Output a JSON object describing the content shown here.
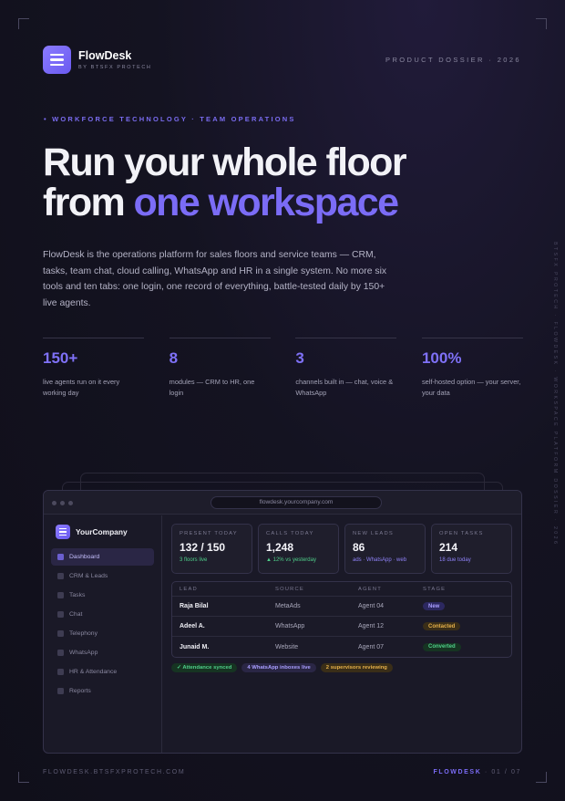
{
  "brand": {
    "name": "FlowDesk",
    "sub": "BY BTSFX PROTECH",
    "logo_icon": "stack-lines-icon"
  },
  "dossier": "PRODUCT DOSSIER · 2026",
  "eyebrow": "• WORKFORCE TECHNOLOGY · TEAM OPERATIONS",
  "headline": {
    "line1": "Run your whole floor",
    "line2_plain": "from ",
    "line2_accent": "one workspace"
  },
  "lede": "FlowDesk is the operations platform for sales floors and service teams — CRM, tasks, team chat, cloud calling, WhatsApp and HR in a single system. No more six tools and ten tabs: one login, one record of everything, battle-tested daily by 150+ live agents.",
  "stats": [
    {
      "num": "150+",
      "label": "live agents run on it every working day"
    },
    {
      "num": "8",
      "label": "modules — CRM to HR, one login"
    },
    {
      "num": "3",
      "label": "channels built in — chat, voice & WhatsApp"
    },
    {
      "num": "100%",
      "label": "self-hosted option — your server, your data"
    }
  ],
  "side_text": "BTSFX PROTECH · FLOWDESK · WORKSPACE PLATFORM DOSSIER · 2026",
  "app": {
    "url": "flowdesk.yourcompany.com",
    "company": "YourCompany",
    "nav": [
      "Dashboard",
      "CRM & Leads",
      "Tasks",
      "Chat",
      "Telephony",
      "WhatsApp",
      "HR & Attendance",
      "Reports"
    ],
    "cards": [
      {
        "label": "PRESENT TODAY",
        "value": "132 / 150",
        "sub": "3 floors live"
      },
      {
        "label": "CALLS TODAY",
        "value": "1,248",
        "sub": "▲ 12% vs yesterday"
      },
      {
        "label": "NEW LEADS",
        "value": "86",
        "sub": "ads · WhatsApp · web"
      },
      {
        "label": "OPEN TASKS",
        "value": "214",
        "sub": "18 due today"
      }
    ],
    "table": {
      "headers": [
        "LEAD",
        "SOURCE",
        "AGENT",
        "STAGE"
      ],
      "rows": [
        [
          "Raja Bilal",
          "MetaAds",
          "Agent 04",
          "New"
        ],
        [
          "Adeel A.",
          "WhatsApp",
          "Agent 12",
          "Contacted"
        ],
        [
          "Junaid M.",
          "Website",
          "Agent 07",
          "Converted"
        ]
      ]
    },
    "tags": [
      "✓ Attendance synced",
      "4 WhatsApp inboxes live",
      "2 supervisors reviewing"
    ]
  },
  "footer": {
    "left": "FLOWDESK.BTSFXPROTECH.COM",
    "right_brand": "FLOWDESK",
    "right_page": " · 01 / 07"
  },
  "colors": {
    "accent": "#7b6cf6",
    "green": "#4fcf8a",
    "amber": "#e5b04a",
    "background": "#141321"
  }
}
